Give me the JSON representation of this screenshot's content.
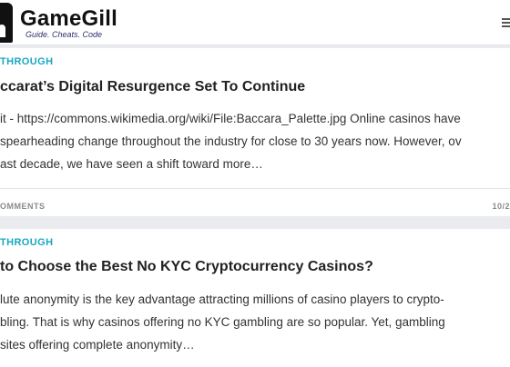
{
  "site": {
    "name": "GameGill",
    "tagline": "Guide. Cheats. Code"
  },
  "articles": [
    {
      "category": "THROUGH",
      "title": "ccarat’s Digital Resurgence Set To Continue",
      "excerpt_lines": [
        "it - https://commons.wikimedia.org/wiki/File:Baccara_Palette.jpg  Online casinos have",
        "spearheading change throughout the industry for close to 30 years now. However, ov",
        "ast decade, we have seen a shift toward more…"
      ],
      "comments": "OMMENTS",
      "date": "10/2"
    },
    {
      "category": "THROUGH",
      "title": "to Choose the Best No KYC Cryptocurrency Casinos?",
      "excerpt_lines": [
        "lute anonymity is the key advantage attracting millions of casino players to crypto-",
        "bling. That is why casinos offering no KYC gambling are so popular. Yet, gambling",
        "sites offering complete anonymity…"
      ]
    }
  ],
  "colors": {
    "accent": "#1aa7c2",
    "background": "#e9ebee"
  }
}
